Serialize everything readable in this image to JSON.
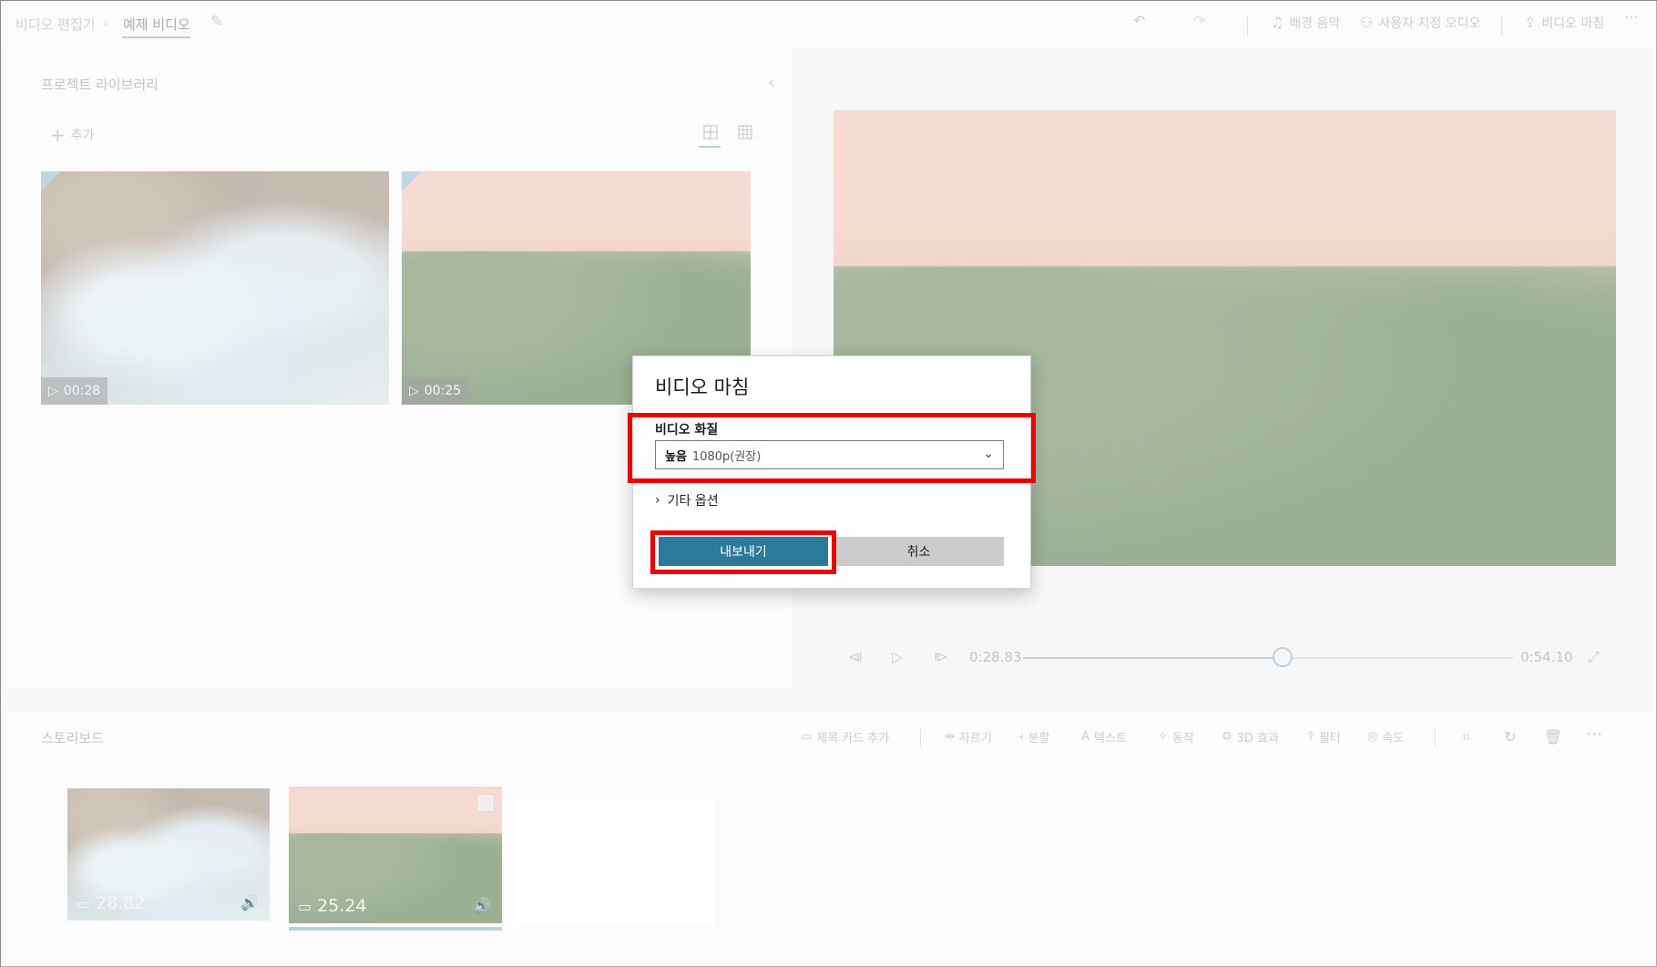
{
  "breadcrumb": {
    "root": "비디오 편집기",
    "current": "예제 비디오"
  },
  "toolbar": {
    "background_music": "배경 음악",
    "custom_audio": "사용자 지정 오디오",
    "finish_video": "비디오 마침"
  },
  "library": {
    "title": "프로젝트 라이브러리",
    "add_label": "추가",
    "items": [
      {
        "duration": "00:28"
      },
      {
        "duration": "00:25"
      }
    ]
  },
  "player": {
    "current_time": "0:28.83",
    "total_time": "0:54.10",
    "progress": 0.53
  },
  "storyboard": {
    "title": "스토리보드",
    "tools": {
      "title_card": "제목 카드 추가",
      "trim": "자르기",
      "split": "분할",
      "text": "텍스트",
      "motion": "동작",
      "effects_3d": "3D 효과",
      "filters": "필터",
      "speed": "속도"
    },
    "clips": [
      {
        "duration": "28.82"
      },
      {
        "duration": "25.24"
      }
    ]
  },
  "dialog": {
    "title": "비디오 마침",
    "quality_label": "비디오 화질",
    "quality_value_strong": "높음",
    "quality_value_rest": "1080p(권장)",
    "more_options": "기타 옵션",
    "export_button": "내보내기",
    "cancel_button": "취소"
  },
  "colors": {
    "accent": "#2b7a9b",
    "highlight": "#ee0000",
    "slider": "#9fbccb"
  }
}
